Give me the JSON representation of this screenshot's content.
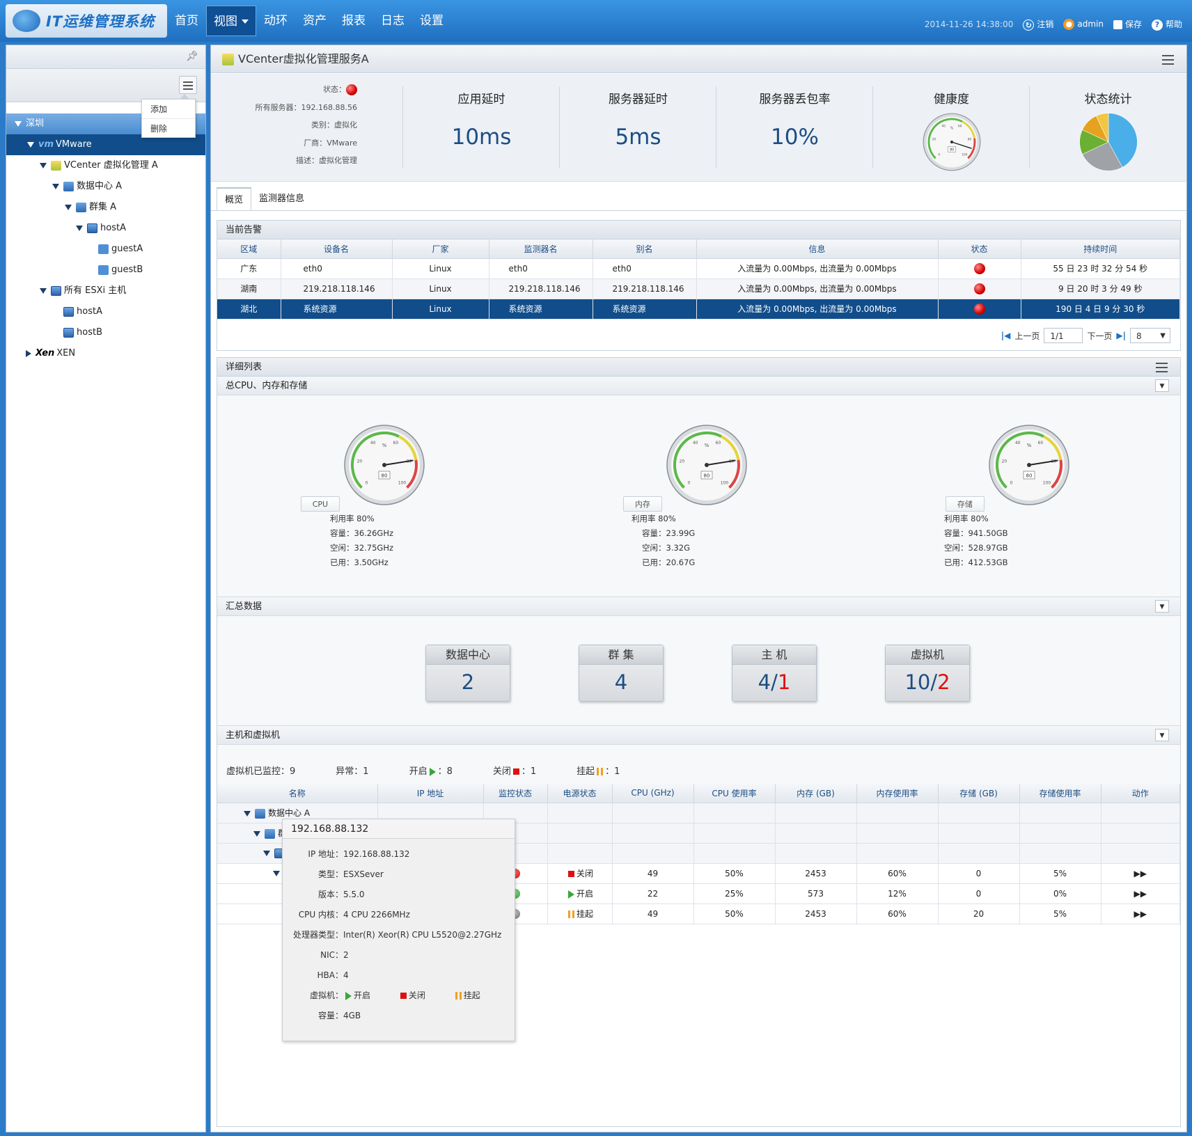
{
  "app": {
    "title": "IT运维管理系统"
  },
  "nav": {
    "items": [
      "首页",
      "视图",
      "动环",
      "资产",
      "报表",
      "日志",
      "设置"
    ],
    "active": "视图"
  },
  "topright": {
    "timestamp": "2014-11-26 14:38:00",
    "logout": "注销",
    "user": "admin",
    "save": "保存",
    "help": "帮助"
  },
  "sidebar": {
    "context_menu": [
      "添加",
      "删除"
    ],
    "tree": [
      {
        "label": "深圳"
      },
      {
        "label": "VMware",
        "prefix": "vm"
      },
      {
        "label": "VCenter 虚拟化管理 A"
      },
      {
        "label": "数据中心 A"
      },
      {
        "label": "群集 A"
      },
      {
        "label": "hostA"
      },
      {
        "label": "guestA"
      },
      {
        "label": "guestB"
      },
      {
        "label": "所有 ESXi 主机"
      },
      {
        "label": "hostA"
      },
      {
        "label": "hostB"
      },
      {
        "label": "XEN",
        "prefix": "Xen"
      }
    ]
  },
  "main": {
    "title": "VCenter虚拟化管理服务A",
    "info": {
      "status_label": "状态：",
      "server_label": "所有服务器：",
      "server": "192.168.88.56",
      "type_label": "类别：",
      "type": "虚拟化",
      "vendor_label": "厂商：",
      "vendor": "VMware",
      "desc_label": "描述：",
      "desc": "虚拟化管理"
    },
    "stats": [
      {
        "label": "应用延时",
        "value": "10ms"
      },
      {
        "label": "服务器延时",
        "value": "5ms"
      },
      {
        "label": "服务器丢包率",
        "value": "10%"
      }
    ],
    "health": {
      "label": "健康度",
      "value": 90
    },
    "status_stats": {
      "label": "状态统计",
      "slices": [
        {
          "value": 42,
          "color": "#4aaee8"
        },
        {
          "value": 26,
          "color": "#9fa3a8"
        },
        {
          "value": 14,
          "color": "#6cb033"
        },
        {
          "value": 11,
          "color": "#e6a21e"
        },
        {
          "value": 7,
          "color": "#f3c640"
        }
      ]
    },
    "tabs": [
      "概览",
      "监测器信息"
    ]
  },
  "alarms": {
    "title": "当前告警",
    "columns": [
      "区域",
      "设备名",
      "厂家",
      "监测器名",
      "别名",
      "信息",
      "状态",
      "持续时间"
    ],
    "rows": [
      [
        "广东",
        "eth0",
        "Linux",
        "eth0",
        "eth0",
        "入流量为 0.00Mbps, 出流量为 0.00Mbps",
        "",
        "55 日 23 时 32 分 54 秒"
      ],
      [
        "湖南",
        "219.218.118.146",
        "Linux",
        "219.218.118.146",
        "219.218.118.146",
        "入流量为 0.00Mbps, 出流量为 0.00Mbps",
        "",
        "9 日 20 时 3 分 49 秒"
      ],
      [
        "湖北",
        "系统资源",
        "Linux",
        "系统资源",
        "系统资源",
        "入流量为 0.00Mbps, 出流量为 0.00Mbps",
        "",
        "190 日 4 日 9 分 30 秒"
      ]
    ],
    "pager": {
      "prev": "上一页",
      "page": "1/1",
      "next": "下一页",
      "size": "8"
    }
  },
  "detail": {
    "title": "详细列表",
    "sub1": "总CPU、内存和存储",
    "gauges": [
      {
        "tag": "CPU",
        "value": 80,
        "util": "利用率 80%",
        "cap": "容量：36.26GHz",
        "free": "空闲：32.75GHz",
        "used": "已用：3.50GHz"
      },
      {
        "tag": "内存",
        "value": 80,
        "util": "利用率 80%",
        "cap": "容量：23.99G",
        "free": "空闲：3.32G",
        "used": "已用：20.67G"
      },
      {
        "tag": "存储",
        "value": 80,
        "util": "利用率 80%",
        "cap": "容量：941.50GB",
        "free": "空闲：528.97GB",
        "used": "已用：412.53GB"
      }
    ],
    "sub2": "汇总数据",
    "cards": [
      {
        "title": "数据中心",
        "value": "2",
        "red": ""
      },
      {
        "title": "群 集",
        "value": "4",
        "red": ""
      },
      {
        "title": "主 机",
        "value": "4/",
        "red": "1"
      },
      {
        "title": "虚拟机",
        "value": "10/",
        "red": "2"
      }
    ],
    "sub3": "主机和虚拟机",
    "vmline": {
      "monitored": "虚拟机已监控：9",
      "abnormal": "异常：1",
      "on": "开启",
      "on_count": "：8",
      "off": "关闭",
      "off_count": "：1",
      "pause": "挂起",
      "pause_count": "：1"
    },
    "columns": [
      "名称",
      "IP 地址",
      "监控状态",
      "电源状态",
      "CPU (GHz)",
      "CPU 使用率",
      "内存 (GB)",
      "内存使用率",
      "存储 (GB)",
      "存储使用率",
      "动作"
    ],
    "tree_rows": [
      "数据中心 A",
      "群"
    ],
    "vm_rows": [
      {
        "power": "关闭",
        "cpu": "49",
        "cpu_rate": "50%",
        "mem": "2453",
        "mem_rate": "60%",
        "sto": "0",
        "sto_rate": "5%"
      },
      {
        "power": "开启",
        "cpu": "22",
        "cpu_rate": "25%",
        "mem": "573",
        "mem_rate": "12%",
        "sto": "0",
        "sto_rate": "0%"
      },
      {
        "power": "挂起",
        "cpu": "49",
        "cpu_rate": "50%",
        "mem": "2453",
        "mem_rate": "60%",
        "sto": "20",
        "sto_rate": "5%"
      }
    ]
  },
  "tooltip": {
    "title": "192.168.88.132",
    "rows": [
      {
        "k": "IP 地址：",
        "v": "192.168.88.132"
      },
      {
        "k": "类型：",
        "v": "ESXSever"
      },
      {
        "k": "版本：",
        "v": "5.5.0"
      },
      {
        "k": "CPU 内核：",
        "v": "4 CPU 2266MHz"
      },
      {
        "k": "处理器类型：",
        "v": "Inter(R) Xeor(R) CPU L5520@2.27GHz"
      },
      {
        "k": "NIC：",
        "v": "2"
      },
      {
        "k": "HBA：",
        "v": "4"
      }
    ],
    "vm_label": "虚拟机：",
    "vm_on": "开启",
    "vm_off": "关闭",
    "vm_pause": "挂起",
    "cap_label": "容量：",
    "cap": "4GB"
  },
  "colors": {
    "accent": "#1f6fc0",
    "selected": "#114d8a",
    "danger": "#d40000",
    "value_blue": "#1d4d83"
  }
}
